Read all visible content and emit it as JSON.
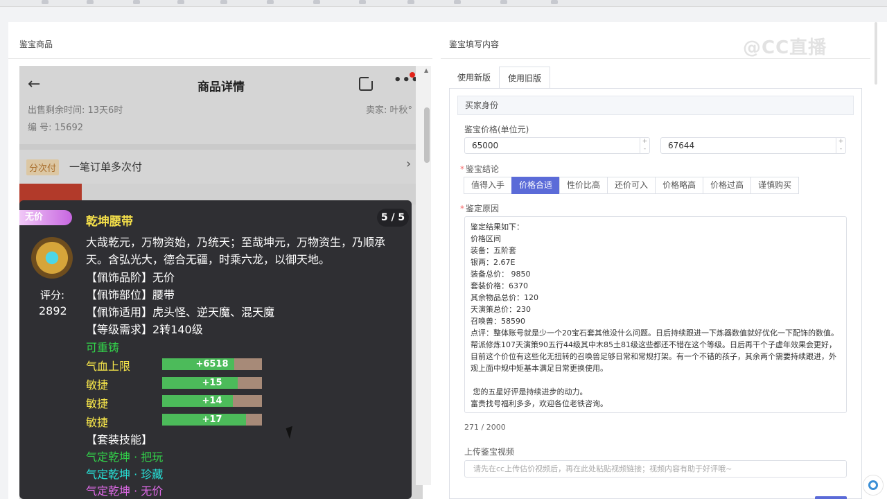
{
  "left_section": {
    "title": "鉴宝商品"
  },
  "right_section": {
    "title": "鉴宝填写内容"
  },
  "watermark": "@CC直播",
  "phone": {
    "header_title": "商品详情",
    "sale_time": "出售剩余时间: 13天6时",
    "seller": "卖家: 叶秋°",
    "serial": "编 号: 15692",
    "pay_tag": "分次付",
    "pay_text": "一笔订单多次付"
  },
  "tooltip": {
    "badge": "无价",
    "score_label": "评分:",
    "score_value": "2892",
    "name": "乾坤腰带",
    "page": "5 / 5",
    "description": "大哉乾元，万物资始，乃统天；至哉坤元，万物资生，乃顺承天。含弘光大，德合无疆，时乘六龙，以御天地。",
    "grade": "【佩饰品阶】无价",
    "slot": "【佩饰部位】腰带",
    "applicable": "【佩饰适用】虎头怪、逆天魔、混天魔",
    "level": "【等级需求】2转140级",
    "recast": "可重铸",
    "stats": [
      {
        "label": "气血上限",
        "value": "+6518",
        "fill": 0.72
      },
      {
        "label": "敏捷",
        "value": "+15",
        "fill": 0.76
      },
      {
        "label": "敏捷",
        "value": "+14",
        "fill": 0.71
      },
      {
        "label": "敏捷",
        "value": "+17",
        "fill": 0.84
      }
    ],
    "set_skill_title": "【套装技能】",
    "skills": [
      "气定乾坤 · 把玩",
      "气定乾坤 · 珍藏",
      "气定乾坤 · 无价"
    ]
  },
  "form": {
    "tabs": [
      "使用新版",
      "使用旧版"
    ],
    "buyer_identity": "买家身份",
    "price_label": "鉴宝价格(单位元)",
    "price_min": "65000",
    "price_max": "67644",
    "conclusion_label": "鉴宝结论",
    "conclusions": [
      "值得入手",
      "价格合适",
      "性价比高",
      "还价可入",
      "价格略高",
      "价格过高",
      "谨慎购买"
    ],
    "conclusion_selected": "价格合适",
    "reason_label": "鉴定原因",
    "reason_lines": [
      "鉴定结果如下：",
      "价格区间",
      "装备：五阶套",
      "银两：2.67E",
      "装备总价： 9850",
      "套装价格：6370",
      "其余物品总价：120",
      "天演策总价：230",
      "召唤兽：58590",
      "点评：整体账号就是少一个20宝石套其他没什么问题。日后持续跟进一下炼器数值就好优化一下配饰的数值。帮派修炼107天演策90五行44级其中木85土81级这些都还不错在这个等级。日后再干个子虚年效果会更好，目前这个价位有这些化无扭转的召唤兽足够日常和常规打架。有一个不错的孩子，其余两个需要持续跟进，外观上面中规中矩基本满足日常更换使用。",
      "",
      " 您的五星好评是持续进步的动力。",
      "富贵找号福利多多，欢迎各位老铁咨询。"
    ],
    "char_count": "271 / 2000",
    "video_label": "上传鉴宝视频",
    "video_placeholder": "请先在cc上传估价视频后，再在此处粘贴视频链接；视频内容有助于好评哦~"
  }
}
